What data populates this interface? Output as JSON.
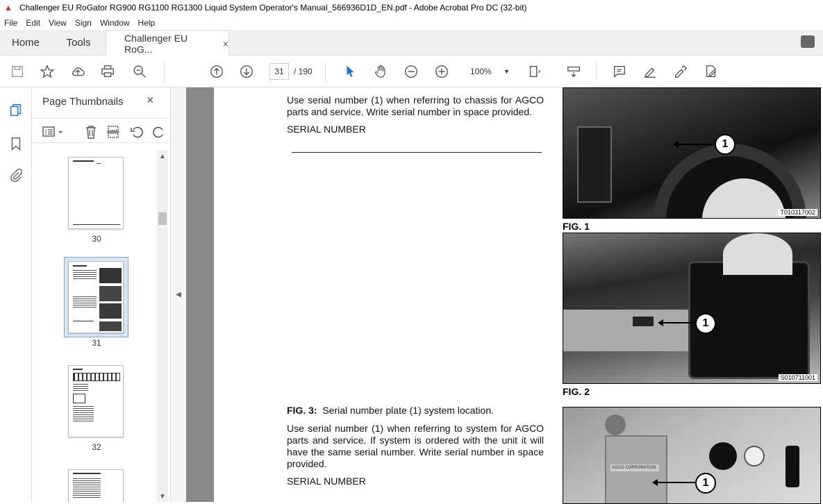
{
  "window": {
    "title": "Challenger EU RoGator RG900 RG1100 RG1300 Liquid System Operator's Manual_566936D1D_EN.pdf - Adobe Acrobat Pro DC (32-bit)"
  },
  "menu": {
    "items": [
      "File",
      "Edit",
      "View",
      "Sign",
      "Window",
      "Help"
    ]
  },
  "tabs": {
    "home": "Home",
    "tools": "Tools",
    "document": "Challenger EU RoG...",
    "close": "×"
  },
  "toolbar": {
    "page_current": "31",
    "page_total": "/ 190",
    "zoom": "100%"
  },
  "panel": {
    "title": "Page Thumbnails",
    "close": "×",
    "thumbnails": [
      {
        "label": "30"
      },
      {
        "label": "31",
        "selected": true
      },
      {
        "label": "32"
      }
    ]
  },
  "document": {
    "para1": "Use serial number (1) when referring to chassis for AGCO parts and service. Write serial number in space provided.",
    "serial_heading_1": "SERIAL NUMBER",
    "fig3_label": "FIG. 3:",
    "fig3_caption": "Serial number plate (1) system location.",
    "para2": "Use serial number (1) when referring to system for AGCO parts and service. If system is ordered with the unit it will have the same serial number. Write serial number in space provided.",
    "serial_heading_2": "SERIAL NUMBER",
    "figures": [
      {
        "label": "FIG. 1",
        "code": "T010317002",
        "callout": "1"
      },
      {
        "label": "FIG. 2",
        "code": "S010711001",
        "callout": "1"
      },
      {
        "label": "",
        "code": "",
        "callout": "1",
        "plate_text": "AGCO CORPORATION"
      }
    ]
  },
  "colors": {
    "acrobat_red": "#d8241b",
    "viewer_bg": "#888888",
    "selection": "#d6e6f5"
  }
}
